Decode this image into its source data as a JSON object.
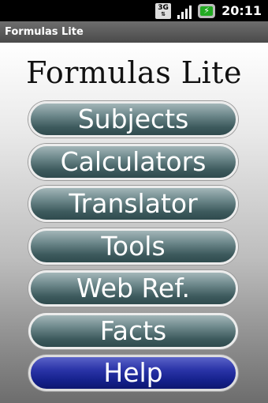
{
  "status_bar": {
    "network_type": "3G",
    "network_arrows": "⇅",
    "clock": "20:11"
  },
  "title_bar": {
    "title": "Formulas Lite"
  },
  "app": {
    "heading": "Formulas Lite"
  },
  "menu": {
    "items": [
      {
        "label": "Subjects",
        "color": "#4f6b6e"
      },
      {
        "label": "Calculators",
        "color": "#4f6b6e"
      },
      {
        "label": "Translator",
        "color": "#4f6b6e"
      },
      {
        "label": "Tools",
        "color": "#4f6b6e"
      },
      {
        "label": "Web Ref.",
        "color": "#4f6b6e"
      },
      {
        "label": "Facts",
        "color": "#4f6b6e"
      },
      {
        "label": "Help",
        "color": "#1a2690"
      }
    ]
  }
}
